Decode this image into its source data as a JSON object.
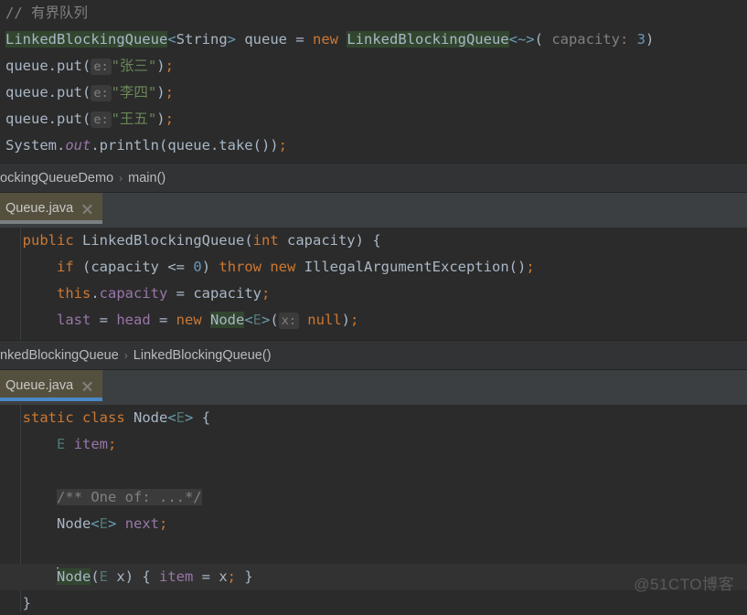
{
  "editor": {
    "theme_bg": "#2b2b2b",
    "accent": "#4a88c7",
    "tab_bg": "#55503e"
  },
  "pane_top": {
    "lines": [
      {
        "id": "line-comment",
        "tokens": [
          {
            "t": "cmt",
            "text": "// 有界队列"
          }
        ]
      },
      {
        "id": "line-declare",
        "tokens": [
          {
            "t": "ident-hl",
            "text": "LinkedBlockingQueue"
          },
          {
            "t": "angle",
            "text": "<"
          },
          {
            "t": "plain",
            "text": "String"
          },
          {
            "t": "angle",
            "text": ">"
          },
          {
            "t": "plain",
            "text": " queue "
          },
          {
            "t": "plain",
            "text": "= "
          },
          {
            "t": "kw",
            "text": "new "
          },
          {
            "t": "ident-hl",
            "text": "LinkedBlockingQueue"
          },
          {
            "t": "angle",
            "text": "<~>"
          },
          {
            "t": "punct",
            "text": "("
          },
          {
            "t": "hint",
            "text": " capacity: "
          },
          {
            "t": "num",
            "text": "3"
          },
          {
            "t": "punct",
            "text": ")"
          }
        ]
      },
      {
        "id": "line-put-1",
        "tokens": [
          {
            "t": "plain",
            "text": "queue.put("
          },
          {
            "t": "hintbg",
            "text": "e:"
          },
          {
            "t": "str",
            "text": "\"张三\""
          },
          {
            "t": "punct",
            "text": ")"
          },
          {
            "t": "semi",
            "text": ";"
          }
        ]
      },
      {
        "id": "line-put-2",
        "tokens": [
          {
            "t": "plain",
            "text": "queue.put("
          },
          {
            "t": "hintbg",
            "text": "e:"
          },
          {
            "t": "str",
            "text": "\"李四\""
          },
          {
            "t": "punct",
            "text": ")"
          },
          {
            "t": "semi",
            "text": ";"
          }
        ]
      },
      {
        "id": "line-put-3",
        "tokens": [
          {
            "t": "plain",
            "text": "queue.put("
          },
          {
            "t": "hintbg",
            "text": "e:"
          },
          {
            "t": "str",
            "text": "\"王五\""
          },
          {
            "t": "punct",
            "text": ")"
          },
          {
            "t": "semi",
            "text": ";"
          }
        ]
      },
      {
        "id": "line-println",
        "tokens": [
          {
            "t": "plain",
            "text": "System."
          },
          {
            "t": "fld-italic",
            "text": "out"
          },
          {
            "t": "plain",
            "text": ".println(queue.take())"
          },
          {
            "t": "semi",
            "text": ";"
          }
        ]
      }
    ]
  },
  "breadcrumb_top": {
    "segments": [
      "ockingQueueDemo",
      "main()"
    ],
    "separator": "›"
  },
  "tab_middle": {
    "label": "Queue.java",
    "close_icon": "close-icon",
    "underline_state": "inactive"
  },
  "pane_middle": {
    "lines": [
      {
        "id": "line-ctor",
        "tokens": [
          {
            "t": "indent",
            "text": "  "
          },
          {
            "t": "kw",
            "text": "public "
          },
          {
            "t": "plain",
            "text": "LinkedBlockingQueue"
          },
          {
            "t": "punct",
            "text": "("
          },
          {
            "t": "kw",
            "text": "int"
          },
          {
            "t": "plain",
            "text": " capacity"
          },
          {
            "t": "punct",
            "text": ") {"
          }
        ]
      },
      {
        "id": "line-if",
        "tokens": [
          {
            "t": "indent",
            "text": "      "
          },
          {
            "t": "kw",
            "text": "if "
          },
          {
            "t": "punct",
            "text": "("
          },
          {
            "t": "plain",
            "text": "capacity "
          },
          {
            "t": "plain",
            "text": "<= "
          },
          {
            "t": "num",
            "text": "0"
          },
          {
            "t": "punct",
            "text": ") "
          },
          {
            "t": "kw",
            "text": "throw new "
          },
          {
            "t": "plain",
            "text": "IllegalArgumentException()"
          },
          {
            "t": "semi",
            "text": ";"
          }
        ]
      },
      {
        "id": "line-assign-capacity",
        "tokens": [
          {
            "t": "indent",
            "text": "      "
          },
          {
            "t": "kw",
            "text": "this"
          },
          {
            "t": "plain",
            "text": "."
          },
          {
            "t": "fld",
            "text": "capacity"
          },
          {
            "t": "plain",
            "text": " = capacity"
          },
          {
            "t": "semi",
            "text": ";"
          }
        ]
      },
      {
        "id": "line-last-head",
        "tokens": [
          {
            "t": "indent",
            "text": "      "
          },
          {
            "t": "fld",
            "text": "last"
          },
          {
            "t": "plain",
            "text": " = "
          },
          {
            "t": "fld",
            "text": "head"
          },
          {
            "t": "plain",
            "text": " = "
          },
          {
            "t": "kw",
            "text": "new "
          },
          {
            "t": "ident-hl",
            "text": "Node"
          },
          {
            "t": "angle",
            "text": "<"
          },
          {
            "t": "gen",
            "text": "E"
          },
          {
            "t": "angle",
            "text": ">"
          },
          {
            "t": "punct",
            "text": "("
          },
          {
            "t": "hintbg",
            "text": "x:"
          },
          {
            "t": "kw",
            "text": " null"
          },
          {
            "t": "punct",
            "text": ")"
          },
          {
            "t": "semi",
            "text": ";"
          }
        ]
      }
    ]
  },
  "breadcrumb_middle": {
    "segments": [
      "nkedBlockingQueue",
      "LinkedBlockingQueue()"
    ],
    "separator": "›"
  },
  "tab_bottom": {
    "label": "Queue.java",
    "close_icon": "close-icon",
    "underline_state": "active"
  },
  "pane_bottom": {
    "lines": [
      {
        "id": "line-node-class",
        "tokens": [
          {
            "t": "indent",
            "text": "  "
          },
          {
            "t": "kw",
            "text": "static class "
          },
          {
            "t": "plain",
            "text": "Node"
          },
          {
            "t": "angle",
            "text": "<"
          },
          {
            "t": "gen",
            "text": "E"
          },
          {
            "t": "angle",
            "text": ">"
          },
          {
            "t": "punct",
            "text": " {"
          }
        ]
      },
      {
        "id": "line-item-field",
        "tokens": [
          {
            "t": "indent",
            "text": "      "
          },
          {
            "t": "gen",
            "text": "E"
          },
          {
            "t": "plain",
            "text": " "
          },
          {
            "t": "fld",
            "text": "item"
          },
          {
            "t": "semi",
            "text": ";"
          }
        ]
      },
      {
        "id": "line-blank-1",
        "tokens": []
      },
      {
        "id": "line-javadoc-fold",
        "tokens": [
          {
            "t": "indent",
            "text": "      "
          },
          {
            "t": "fold",
            "text": "/** One of: ...*/"
          }
        ]
      },
      {
        "id": "line-next-field",
        "tokens": [
          {
            "t": "indent",
            "text": "      "
          },
          {
            "t": "plain",
            "text": "Node"
          },
          {
            "t": "angle",
            "text": "<"
          },
          {
            "t": "gen",
            "text": "E"
          },
          {
            "t": "angle",
            "text": "> "
          },
          {
            "t": "fld",
            "text": "next"
          },
          {
            "t": "semi",
            "text": ";"
          }
        ]
      },
      {
        "id": "line-blank-2",
        "tokens": []
      },
      {
        "id": "line-node-ctor",
        "caret_row": true,
        "tokens": [
          {
            "t": "indent",
            "text": "      "
          },
          {
            "t": "caret",
            "text": ""
          },
          {
            "t": "ident-hl",
            "text": "Node"
          },
          {
            "t": "punct",
            "text": "("
          },
          {
            "t": "gen",
            "text": "E"
          },
          {
            "t": "plain",
            "text": " x"
          },
          {
            "t": "punct",
            "text": ") { "
          },
          {
            "t": "fld",
            "text": "item"
          },
          {
            "t": "plain",
            "text": " = x"
          },
          {
            "t": "semi",
            "text": "; "
          },
          {
            "t": "punct",
            "text": "}"
          }
        ]
      },
      {
        "id": "line-close-brace",
        "tokens": [
          {
            "t": "indent",
            "text": "  "
          },
          {
            "t": "punct",
            "text": "}"
          }
        ]
      }
    ]
  },
  "watermark": {
    "text": "@51CTO博客"
  }
}
